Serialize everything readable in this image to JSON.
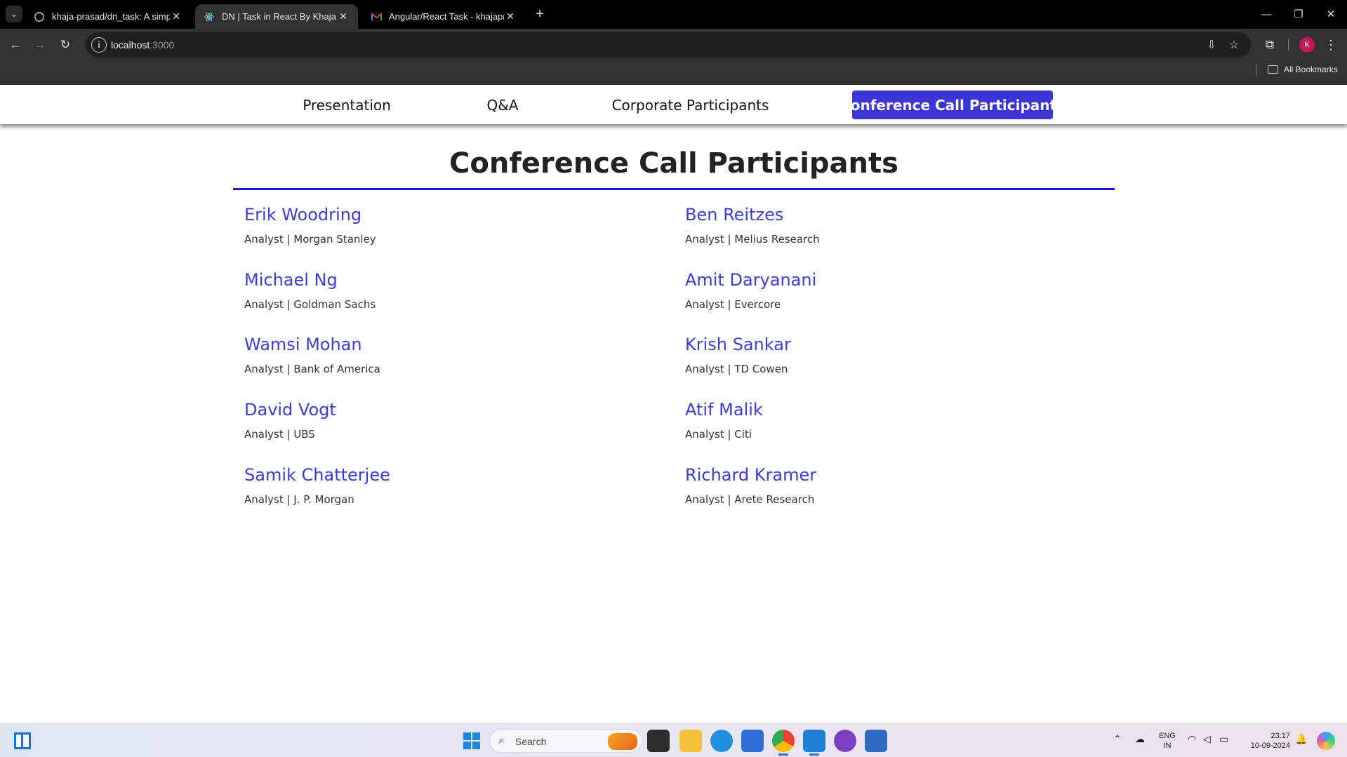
{
  "browser": {
    "tabs": [
      {
        "title": "khaja-prasad/dn_task: A simple",
        "icon": "github-icon",
        "active": false
      },
      {
        "title": "DN | Task in React By Khaja",
        "icon": "react-icon",
        "active": true
      },
      {
        "title": "Angular/React Task - khajapras",
        "icon": "gmail-icon",
        "active": false
      }
    ],
    "url_host": "localhost",
    "url_port": ":3000",
    "bookmarks_label": "All Bookmarks",
    "profile_initial": "K"
  },
  "nav": {
    "items": [
      {
        "label": "Presentation",
        "active": false
      },
      {
        "label": "Q&A",
        "active": false
      },
      {
        "label": "Corporate Participants",
        "active": false
      },
      {
        "label": "Conference Call Participants",
        "active": true
      }
    ],
    "active_color": "#3b35d6"
  },
  "page": {
    "title": "Conference Call Participants",
    "accent_color": "#3d3dd4",
    "rule_color": "#1d1dd6",
    "participants": [
      {
        "name": "Erik Woodring",
        "role": "Analyst | Morgan Stanley"
      },
      {
        "name": "Ben Reitzes",
        "role": "Analyst | Melius Research"
      },
      {
        "name": "Michael Ng",
        "role": "Analyst | Goldman Sachs"
      },
      {
        "name": "Amit Daryanani",
        "role": "Analyst | Evercore"
      },
      {
        "name": "Wamsi Mohan",
        "role": "Analyst | Bank of America"
      },
      {
        "name": "Krish Sankar",
        "role": "Analyst | TD Cowen"
      },
      {
        "name": "David Vogt",
        "role": "Analyst | UBS"
      },
      {
        "name": "Atif Malik",
        "role": "Analyst | Citi"
      },
      {
        "name": "Samik Chatterjee",
        "role": "Analyst | J. P. Morgan"
      },
      {
        "name": "Richard Kramer",
        "role": "Analyst | Arete Research"
      }
    ]
  },
  "taskbar": {
    "search_label": "Search",
    "lang_line1": "ENG",
    "lang_line2": "IN",
    "time": "23:17",
    "date": "10-09-2024"
  }
}
